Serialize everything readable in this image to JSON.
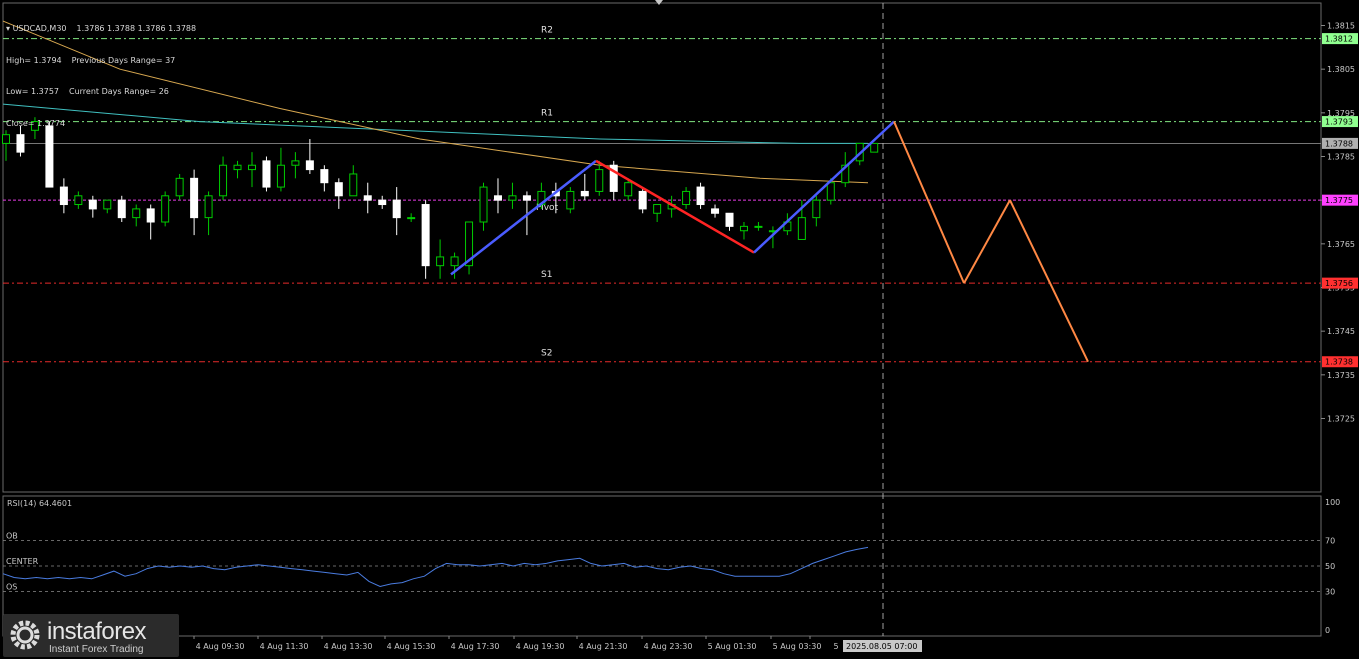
{
  "header": {
    "symbol": "USDCAD,M30",
    "ohlc": "1.3786 1.3788 1.3786 1.3788",
    "high": "High= 1.3794",
    "prev_range": "Previous Days Range= 37",
    "low": "Low= 1.3757",
    "curr_range": "Current Days Range= 26",
    "close": "Close= 1.3774"
  },
  "rsi": {
    "label": "RSI(14) 64.4601",
    "levels": [
      {
        "name": "OB",
        "value": 70
      },
      {
        "name": "CENTER",
        "value": 50
      },
      {
        "name": "OS",
        "value": 30
      }
    ],
    "axis_labels": [
      "100",
      "70",
      "50",
      "30",
      "0"
    ],
    "values": [
      44,
      41,
      40,
      41,
      40,
      41,
      40,
      41,
      40,
      43,
      46,
      42,
      44,
      48,
      50,
      49,
      50,
      49,
      50,
      48,
      47,
      49,
      50,
      51,
      50,
      49,
      48,
      47,
      46,
      45,
      44,
      43,
      45,
      38,
      34,
      36,
      37,
      40,
      42,
      48,
      52,
      51,
      51,
      50,
      51,
      52,
      50,
      52,
      51,
      52,
      54,
      55,
      56,
      52,
      50,
      51,
      52,
      49,
      50,
      48,
      47,
      49,
      50,
      48,
      47,
      44,
      42,
      42,
      42,
      42,
      42,
      44,
      48,
      52,
      55,
      58,
      61,
      63,
      64.5
    ]
  },
  "logo": {
    "name": "instaforex",
    "tagline": "Instant Forex Trading"
  },
  "colors": {
    "background": "#000000",
    "bull_candle": "#00cc00",
    "bear_candle": "#ffffff",
    "ma_slow": "#40c0c0",
    "ma_fast": "#d8a850",
    "wave_blue": "#4a5cff",
    "wave_red": "#ff2424",
    "forecast": "#ff8844",
    "rsi_line": "#4a7ce0"
  },
  "chart_data": {
    "type": "candlestick",
    "symbol": "USDCAD",
    "timeframe": "M30",
    "ylim": [
      1.3718,
      1.3822
    ],
    "y_ticks": [
      "1.3815",
      "1.3805",
      "1.3795",
      "1.3785",
      "1.3775",
      "1.3765",
      "1.3755",
      "1.3745",
      "1.3735",
      "1.3725"
    ],
    "x_labels": [
      "4 Aug 09:30",
      "4 Aug 11:30",
      "4 Aug 13:30",
      "4 Aug 15:30",
      "4 Aug 17:30",
      "4 Aug 19:30",
      "4 Aug 21:30",
      "4 Aug 23:30",
      "5 Aug 01:30",
      "5 Aug 03:30",
      "5",
      "2025.08.05 07:00"
    ],
    "levels": [
      {
        "name": "R2",
        "value": 1.3812,
        "color": "#90ff90"
      },
      {
        "name": "R1",
        "value": 1.3793,
        "color": "#90ff90"
      },
      {
        "name": "Pivot",
        "label": "Pivot",
        "value": 1.3775,
        "color": "#ff40ff"
      },
      {
        "name": "S1",
        "value": 1.3756,
        "color": "#ff3030"
      },
      {
        "name": "S2",
        "value": 1.3738,
        "color": "#ff3030"
      },
      {
        "name": "current",
        "value": 1.3788,
        "color": "#b0b0b0"
      }
    ],
    "candles": [
      [
        1.3788,
        1.3791,
        1.3784,
        1.379
      ],
      [
        1.379,
        1.3792,
        1.3785,
        1.3786
      ],
      [
        1.3791,
        1.3794,
        1.3789,
        1.3793
      ],
      [
        1.3792,
        1.3793,
        1.3778,
        1.3778
      ],
      [
        1.3778,
        1.378,
        1.3772,
        1.3774
      ],
      [
        1.3774,
        1.3777,
        1.3773,
        1.3776
      ],
      [
        1.3775,
        1.3776,
        1.3771,
        1.3773
      ],
      [
        1.3773,
        1.3775,
        1.3772,
        1.3775
      ],
      [
        1.3775,
        1.3776,
        1.377,
        1.3771
      ],
      [
        1.3771,
        1.3774,
        1.3769,
        1.3773
      ],
      [
        1.3773,
        1.3774,
        1.3766,
        1.377
      ],
      [
        1.377,
        1.3777,
        1.3769,
        1.3776
      ],
      [
        1.3776,
        1.3781,
        1.3775,
        1.378
      ],
      [
        1.378,
        1.3782,
        1.3767,
        1.3771
      ],
      [
        1.3771,
        1.3777,
        1.3767,
        1.3776
      ],
      [
        1.3776,
        1.3785,
        1.3775,
        1.3783
      ],
      [
        1.3782,
        1.3784,
        1.378,
        1.3783
      ],
      [
        1.3782,
        1.3786,
        1.3778,
        1.3783
      ],
      [
        1.3784,
        1.3785,
        1.3777,
        1.3778
      ],
      [
        1.3778,
        1.3787,
        1.3777,
        1.3783
      ],
      [
        1.3783,
        1.3786,
        1.378,
        1.3784
      ],
      [
        1.3784,
        1.3789,
        1.3781,
        1.3782
      ],
      [
        1.3782,
        1.3783,
        1.3777,
        1.3779
      ],
      [
        1.3779,
        1.378,
        1.3773,
        1.3776
      ],
      [
        1.3776,
        1.3783,
        1.3776,
        1.3781
      ],
      [
        1.3776,
        1.3779,
        1.3772,
        1.3775
      ],
      [
        1.3775,
        1.3776,
        1.3773,
        1.3774
      ],
      [
        1.3775,
        1.3778,
        1.3767,
        1.3771
      ],
      [
        1.3771,
        1.3772,
        1.377,
        1.3771
      ],
      [
        1.3774,
        1.3775,
        1.3757,
        1.376
      ],
      [
        1.376,
        1.3766,
        1.3757,
        1.3762
      ],
      [
        1.376,
        1.3763,
        1.3757,
        1.3762
      ],
      [
        1.376,
        1.377,
        1.3758,
        1.377
      ],
      [
        1.377,
        1.3779,
        1.3768,
        1.3778
      ],
      [
        1.3776,
        1.378,
        1.3772,
        1.3775
      ],
      [
        1.3775,
        1.3779,
        1.3773,
        1.3776
      ],
      [
        1.3776,
        1.3777,
        1.3767,
        1.3775
      ],
      [
        1.3774,
        1.3779,
        1.3773,
        1.3777
      ],
      [
        1.3777,
        1.3779,
        1.3772,
        1.3776
      ],
      [
        1.3773,
        1.3778,
        1.3772,
        1.3777
      ],
      [
        1.3777,
        1.3781,
        1.3775,
        1.3776
      ],
      [
        1.3777,
        1.3784,
        1.3776,
        1.3782
      ],
      [
        1.3783,
        1.3784,
        1.3775,
        1.3777
      ],
      [
        1.3776,
        1.378,
        1.3775,
        1.3779
      ],
      [
        1.3777,
        1.3778,
        1.3772,
        1.3773
      ],
      [
        1.3772,
        1.3774,
        1.377,
        1.3774
      ],
      [
        1.3773,
        1.3776,
        1.3771,
        1.3774
      ],
      [
        1.3774,
        1.3778,
        1.3773,
        1.3777
      ],
      [
        1.3778,
        1.3779,
        1.3773,
        1.3774
      ],
      [
        1.3773,
        1.3774,
        1.3771,
        1.3772
      ],
      [
        1.3772,
        1.3772,
        1.3768,
        1.3769
      ],
      [
        1.3768,
        1.377,
        1.3766,
        1.3769
      ],
      [
        1.3769,
        1.377,
        1.3768,
        1.3769
      ],
      [
        1.3768,
        1.3769,
        1.3764,
        1.3768
      ],
      [
        1.3768,
        1.3772,
        1.3767,
        1.377
      ],
      [
        1.3766,
        1.3775,
        1.3766,
        1.3771
      ],
      [
        1.3771,
        1.3776,
        1.3769,
        1.3775
      ],
      [
        1.3775,
        1.378,
        1.3774,
        1.3779
      ],
      [
        1.3779,
        1.3786,
        1.3778,
        1.3783
      ],
      [
        1.3784,
        1.3788,
        1.3783,
        1.3788
      ],
      [
        1.3786,
        1.3788,
        1.3786,
        1.3788
      ]
    ],
    "ma_slow": [
      1.3797,
      1.3793,
      1.3791,
      1.3789,
      1.3788,
      1.3788
    ],
    "ma_fast": [
      1.3816,
      1.3805,
      1.3796,
      1.3789,
      1.3783,
      1.378,
      1.3779
    ],
    "wave_blue_1": [
      [
        1.3758
      ],
      [
        1.3784
      ]
    ],
    "wave_red": [
      [
        1.3784
      ],
      [
        1.3763
      ]
    ],
    "wave_blue_2": [
      [
        1.3763
      ],
      [
        1.3793
      ]
    ],
    "forecast": [
      1.3793,
      1.3756,
      1.3775,
      1.3738
    ]
  }
}
